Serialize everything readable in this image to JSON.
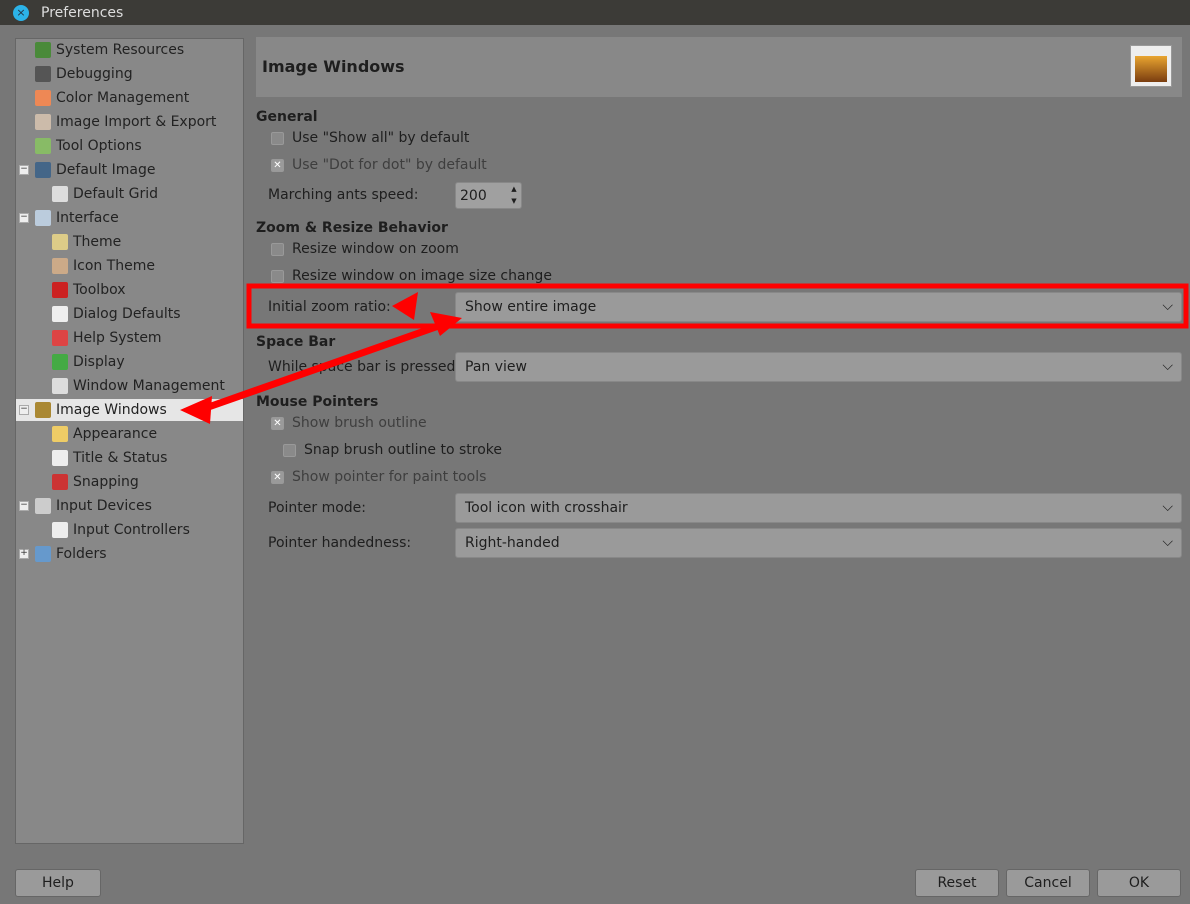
{
  "window": {
    "title": "Preferences"
  },
  "sidebar": {
    "items": [
      {
        "label": "System Resources",
        "color": "#4a8a3a"
      },
      {
        "label": "Debugging",
        "color": "#555"
      },
      {
        "label": "Color Management",
        "color": "#e85"
      },
      {
        "label": "Image Import & Export",
        "color": "#cba"
      },
      {
        "label": "Tool Options",
        "color": "#8b6"
      },
      {
        "label": "Default Image",
        "color": "#468"
      },
      {
        "label": "Default Grid",
        "color": "#ddd"
      },
      {
        "label": "Interface",
        "color": "#bcd"
      },
      {
        "label": "Theme",
        "color": "#dc8"
      },
      {
        "label": "Icon Theme",
        "color": "#ca8"
      },
      {
        "label": "Toolbox",
        "color": "#c22"
      },
      {
        "label": "Dialog Defaults",
        "color": "#eee"
      },
      {
        "label": "Help System",
        "color": "#d44"
      },
      {
        "label": "Display",
        "color": "#4a4"
      },
      {
        "label": "Window Management",
        "color": "#ddd"
      },
      {
        "label": "Image Windows",
        "color": "#a83"
      },
      {
        "label": "Appearance",
        "color": "#ec6"
      },
      {
        "label": "Title & Status",
        "color": "#eee"
      },
      {
        "label": "Snapping",
        "color": "#c33"
      },
      {
        "label": "Input Devices",
        "color": "#ccc"
      },
      {
        "label": "Input Controllers",
        "color": "#eee"
      },
      {
        "label": "Folders",
        "color": "#69c"
      }
    ]
  },
  "page": {
    "title": "Image Windows",
    "general": {
      "heading": "General",
      "show_all": "Use \"Show all\" by default",
      "dot_for_dot": "Use \"Dot for dot\" by default",
      "ants_label": "Marching ants speed:",
      "ants_value": "200"
    },
    "zoom": {
      "heading": "Zoom & Resize Behavior",
      "resize_zoom": "Resize window on zoom",
      "resize_size": "Resize window on image size change",
      "ratio_label": "Initial zoom ratio:",
      "ratio_value": "Show entire image"
    },
    "space": {
      "heading": "Space Bar",
      "label": "While space bar is pressed:",
      "value": "Pan view"
    },
    "mouse": {
      "heading": "Mouse Pointers",
      "brush_outline": "Show brush outline",
      "snap": "Snap brush outline to stroke",
      "pointer_paint": "Show pointer for paint tools",
      "mode_label": "Pointer mode:",
      "mode_value": "Tool icon with crosshair",
      "hand_label": "Pointer handedness:",
      "hand_value": "Right-handed"
    }
  },
  "buttons": {
    "help": "Help",
    "reset": "Reset",
    "cancel": "Cancel",
    "ok": "OK"
  },
  "annotation_color": "#ff0000"
}
